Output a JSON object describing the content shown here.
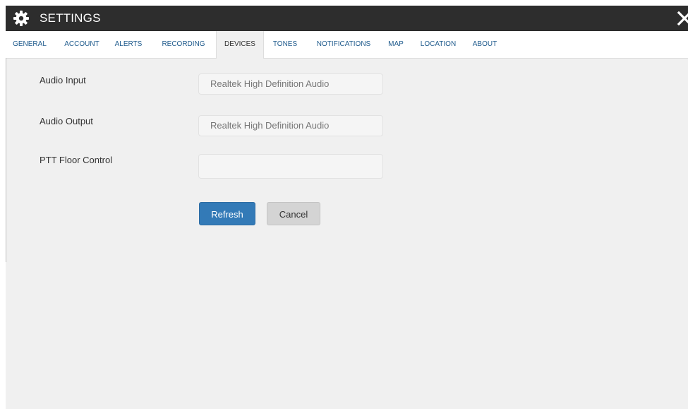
{
  "window": {
    "title": "SETTINGS",
    "title_icon": "gear-icon",
    "close_icon": "close-icon"
  },
  "tabs": [
    {
      "label": "GENERAL",
      "active": false
    },
    {
      "label": "ACCOUNT",
      "active": false
    },
    {
      "label": "ALERTS",
      "active": false
    },
    {
      "label": "RECORDING",
      "active": false
    },
    {
      "label": "DEVICES",
      "active": true
    },
    {
      "label": "TONES",
      "active": false
    },
    {
      "label": "NOTIFICATIONS",
      "active": false
    },
    {
      "label": "MAP",
      "active": false
    },
    {
      "label": "LOCATION",
      "active": false
    },
    {
      "label": "ABOUT",
      "active": false
    }
  ],
  "devices": {
    "audio_input": {
      "label": "Audio Input",
      "value": "Realtek High Definition Audio"
    },
    "audio_output": {
      "label": "Audio Output",
      "value": "Realtek High Definition Audio"
    },
    "ptt_floor_control": {
      "label": "PTT Floor Control",
      "value": ""
    }
  },
  "actions": {
    "refresh_label": "Refresh",
    "cancel_label": "Cancel"
  },
  "colors": {
    "titlebar": "#2d2d2d",
    "tab_link": "#1e5a8c",
    "primary": "#337ab7",
    "panel": "#f0f0f0"
  }
}
